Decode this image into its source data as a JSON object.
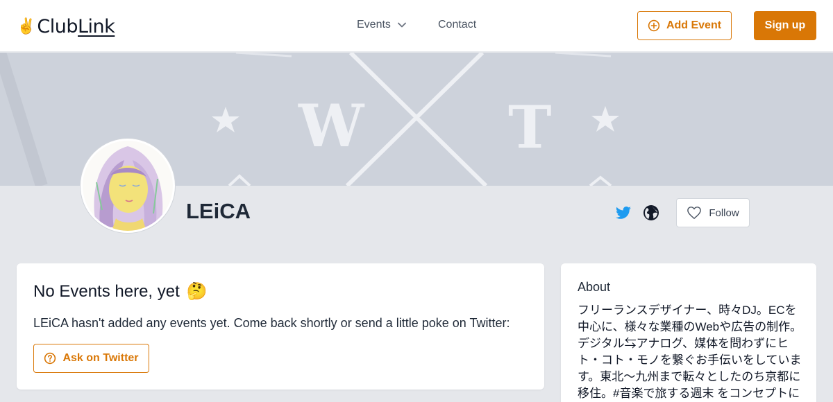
{
  "header": {
    "logo_text_a": "Club",
    "logo_text_b": "Link",
    "logo_glyph": "✌",
    "nav": {
      "events_label": "Events",
      "contact_label": "Contact"
    },
    "add_event_label": "Add Event",
    "signup_label": "Sign up"
  },
  "banner": {
    "letters": [
      "W",
      "T"
    ]
  },
  "profile": {
    "name": "LEiCA",
    "follow_label": "Follow"
  },
  "events_card": {
    "title": "No Events here, yet",
    "emoji": "🤔",
    "text": "LEiCA hasn't added any events yet. Come back shortly or send a little poke on Twitter:",
    "ask_label": "Ask on Twitter"
  },
  "about_card": {
    "title": "About",
    "text": "フリーランスデザイナー、時々DJ。ECを中心に、様々な業種のWebや広告の制作。デジタル⇆アナログ、媒体を問わずにヒト・コト・モノを繋ぐお手伝いをしています。東北～九州まで転々としたのち京都に移住。#音楽で旅する週末 をコンセプトにしたイベン"
  },
  "colors": {
    "accent": "#d97706",
    "twitter": "#1d9bf0",
    "page_bg": "#e5e7eb"
  },
  "icons": [
    "chevron-down-icon",
    "plus-circle-icon",
    "twitter-icon",
    "globe-icon",
    "heart-icon",
    "question-circle-icon"
  ]
}
